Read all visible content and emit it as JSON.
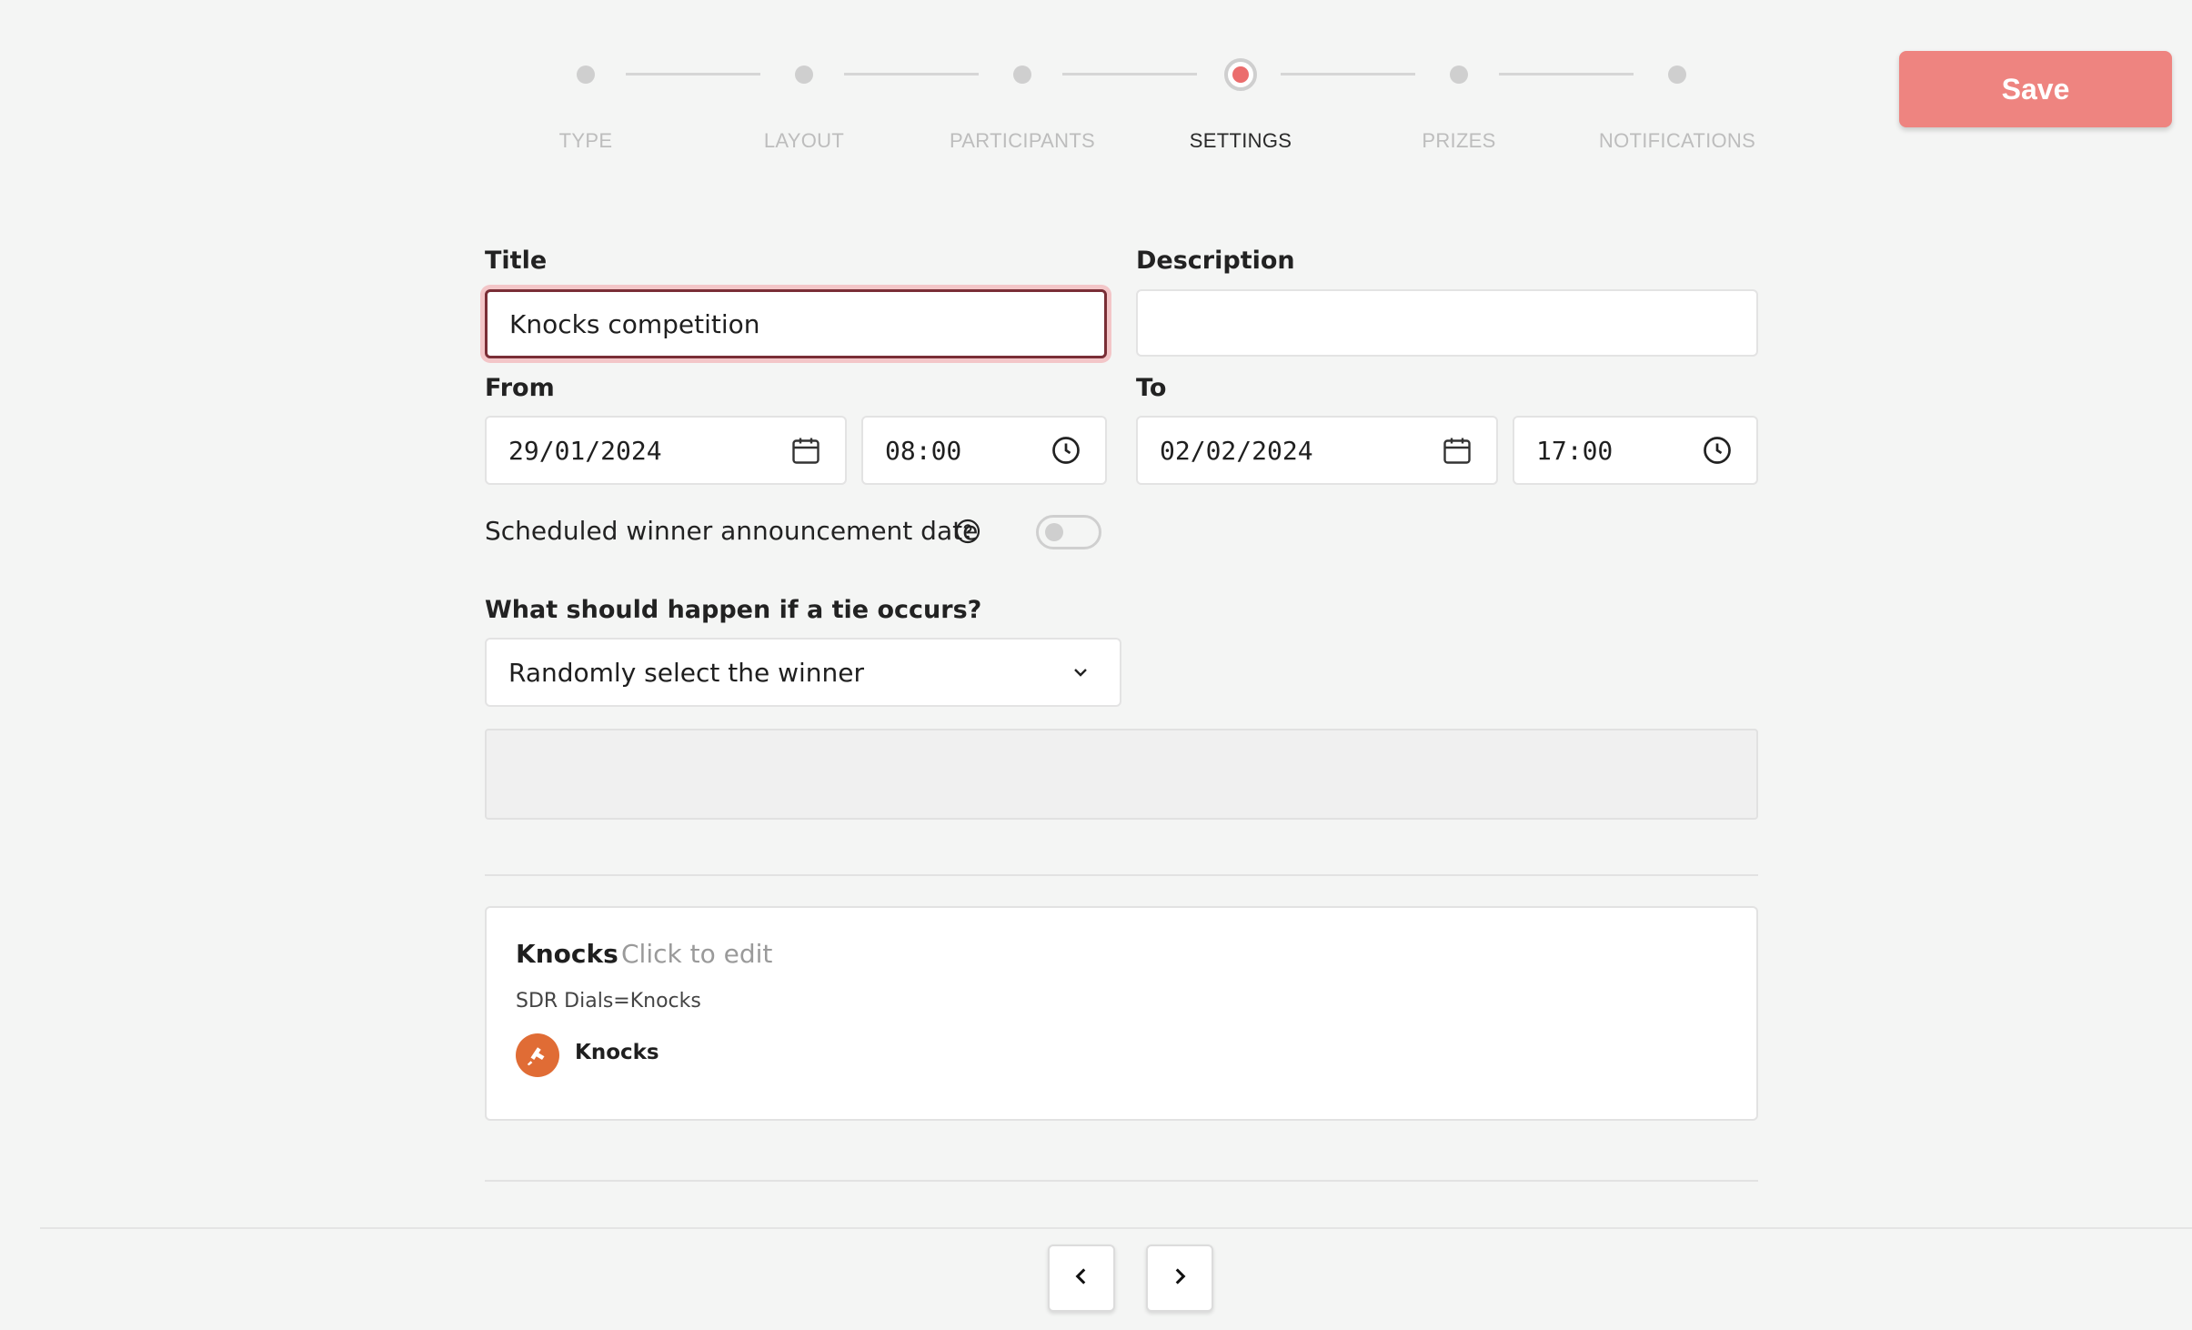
{
  "stepper": {
    "steps": [
      {
        "label": "TYPE",
        "state": "inactive"
      },
      {
        "label": "LAYOUT",
        "state": "inactive"
      },
      {
        "label": "PARTICIPANTS",
        "state": "inactive"
      },
      {
        "label": "SETTINGS",
        "state": "active"
      },
      {
        "label": "PRIZES",
        "state": "inactive"
      },
      {
        "label": "NOTIFICATIONS",
        "state": "inactive"
      }
    ]
  },
  "header": {
    "save_label": "Save"
  },
  "form": {
    "title_label": "Title",
    "title_value": "Knocks competition",
    "description_label": "Description",
    "description_value": "",
    "from_label": "From",
    "from_date": "29/01/2024",
    "from_time": "08:00",
    "to_label": "To",
    "to_date": "02/02/2024",
    "to_time": "17:00",
    "scheduled_label": "Scheduled winner announcement date",
    "scheduled_enabled": false,
    "tie_label": "What should happen if a tie occurs?",
    "tie_value": "Randomly select the winner"
  },
  "metric_card": {
    "title": "Knocks",
    "edit_hint": "Click to edit",
    "subtitle": "SDR Dials=Knocks",
    "item_name": "Knocks"
  },
  "icons": {
    "calendar": "calendar-icon",
    "clock": "clock-icon",
    "help": "help-circle-icon",
    "chevron": "chevron-down-icon",
    "prev": "chevron-left-icon",
    "next": "chevron-right-icon"
  },
  "colors": {
    "accent": "#ee8480",
    "active_dot": "#eb6d6d",
    "focus_border": "#7a2e36",
    "avatar": "#e06c35"
  }
}
